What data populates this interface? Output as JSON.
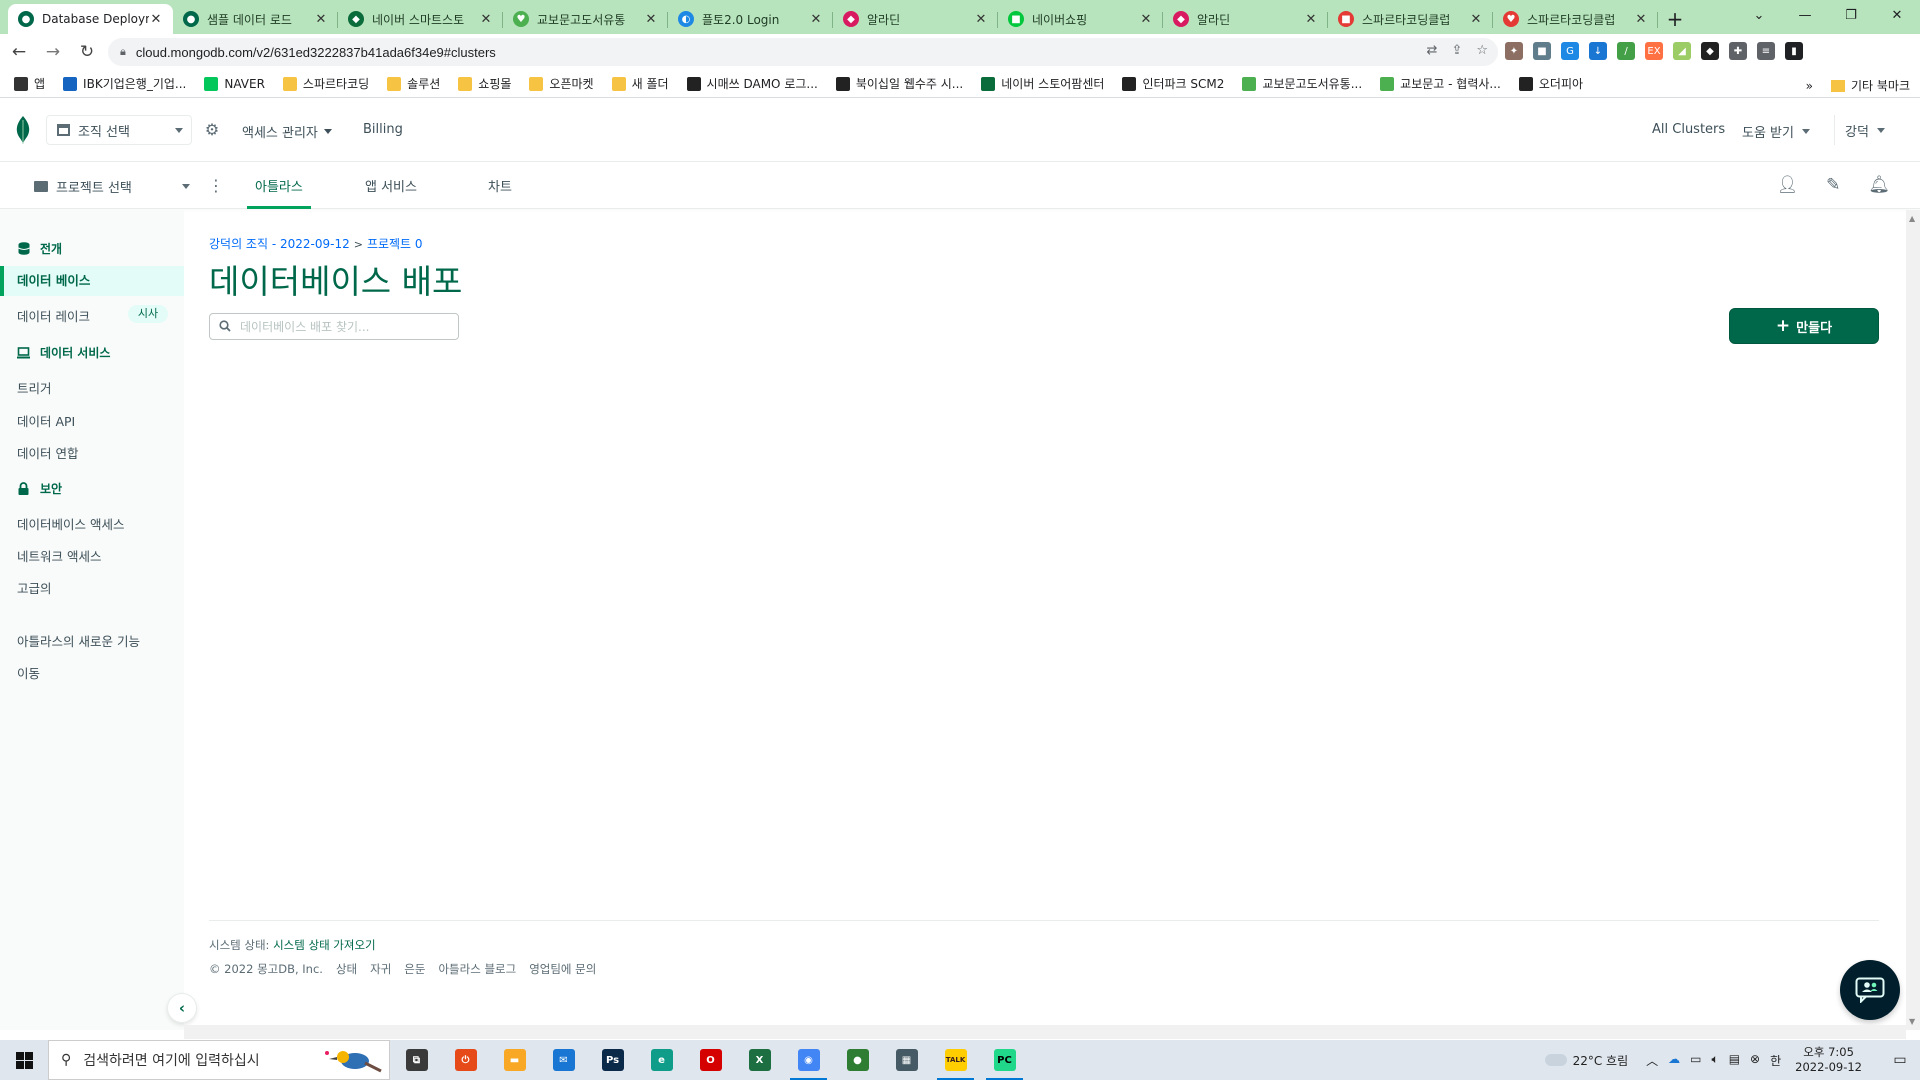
{
  "browser": {
    "tabs": [
      {
        "title": "Database Deploym",
        "color": "#00684a",
        "glyph": "●",
        "active": true
      },
      {
        "title": "샘플 데이터 로드",
        "color": "#00684a",
        "glyph": "●",
        "active": false
      },
      {
        "title": "네이버 스마트스토",
        "color": "#0a6b3b",
        "glyph": "◆",
        "active": false
      },
      {
        "title": "교보문고도서유통",
        "color": "#4caf50",
        "glyph": "♥",
        "active": false
      },
      {
        "title": "플토2.0 Login",
        "color": "#1e88e5",
        "glyph": "◐",
        "active": false
      },
      {
        "title": "알라딘",
        "color": "#d81b60",
        "glyph": "◆",
        "active": false
      },
      {
        "title": "네이버쇼핑",
        "color": "#00c73c",
        "glyph": "■",
        "active": false
      },
      {
        "title": "알라딘",
        "color": "#d81b60",
        "glyph": "◆",
        "active": false
      },
      {
        "title": "스파르타코딩클럽",
        "color": "#e53935",
        "glyph": "■",
        "active": false
      },
      {
        "title": "스파르타코딩클럽",
        "color": "#e53935",
        "glyph": "♥",
        "active": false
      }
    ],
    "new_tab_label": "+",
    "url": "cloud.mongodb.com/v2/631ed3222837b41ada6f34e9#clusters",
    "profile_initials": "강덕",
    "bookmarks": [
      {
        "label": "앱",
        "color": "#333333"
      },
      {
        "label": "IBK기업은행_기업...",
        "color": "#1565c0"
      },
      {
        "label": "NAVER",
        "color": "#03c75a"
      },
      {
        "label": "스파르타코딩",
        "color": "#f6c343"
      },
      {
        "label": "솔루션",
        "color": "#f6c343"
      },
      {
        "label": "쇼핑몰",
        "color": "#f6c343"
      },
      {
        "label": "오픈마켓",
        "color": "#f6c343"
      },
      {
        "label": "새 폴더",
        "color": "#f6c343"
      },
      {
        "label": "시매쓰 DAMO 로그...",
        "color": "#222222"
      },
      {
        "label": "북이십일 웹수주 시...",
        "color": "#222222"
      },
      {
        "label": "네이버 스토어팜센터",
        "color": "#0a6b3b"
      },
      {
        "label": "인터파크 SCM2",
        "color": "#222222"
      },
      {
        "label": "교보문고도서유통...",
        "color": "#4caf50"
      },
      {
        "label": "교보문고 - 협력사...",
        "color": "#4caf50"
      },
      {
        "label": "오더피아",
        "color": "#222222"
      }
    ],
    "bookmarks_overflow": "»",
    "other_bookmarks": "기타 북마크"
  },
  "atlas": {
    "org_select": "조직 선택",
    "access_manager": "액세스 관리자",
    "billing": "Billing",
    "all_clusters": "All Clusters",
    "help": "도움 받기",
    "user": "강덕",
    "project_select": "프로젝트 선택",
    "project_tabs": [
      {
        "label": "아틀라스",
        "active": true
      },
      {
        "label": "앱 서비스",
        "active": false
      },
      {
        "label": "차트",
        "active": false
      }
    ],
    "sidebar": {
      "deployment_head": "전개",
      "database": "데이터 베이스",
      "data_lake": "데이터 레이크",
      "preview_badge": "시사",
      "services_head": "데이터 서비스",
      "triggers": "트리거",
      "data_api": "데이터 API",
      "data_federation": "데이터 연합",
      "security_head": "보안",
      "database_access": "데이터베이스 액세스",
      "network_access": "네트워크 액세스",
      "advanced": "고급의",
      "whats_new": "아틀라스의 새로운 기능",
      "goto": "이동"
    },
    "breadcrumb": {
      "org": "강덕의 조직 - 2022-09-12",
      "separator": ">",
      "project": "프로젝트 0"
    },
    "page_title": "데이터베이스 배포",
    "search_placeholder": "데이터베이스 배포 찾기...",
    "create_button": "만들다",
    "footer": {
      "status_label": "시스템 상태:",
      "status_link": "시스템 상태 가져오기",
      "copyright": "© 2022 몽고DB, Inc.",
      "links": [
        "상태",
        "자귀",
        "은둔",
        "아틀라스 블로그",
        "영업팀에 문의"
      ]
    }
  },
  "taskbar": {
    "search_placeholder": "검색하려면 여기에 입력하십시",
    "apps": [
      {
        "name": "task-view",
        "label": "⧉",
        "color": "#3a3a3a",
        "open": false
      },
      {
        "name": "power-app",
        "label": "⏻",
        "color": "#e64a19",
        "open": false
      },
      {
        "name": "file-explorer",
        "label": "▬",
        "color": "#f9a825",
        "open": false
      },
      {
        "name": "mail",
        "label": "✉",
        "color": "#1976d2",
        "open": false
      },
      {
        "name": "photoshop",
        "label": "Ps",
        "color": "#0b2a4a",
        "open": false
      },
      {
        "name": "edge",
        "label": "e",
        "color": "#0f9d8a",
        "open": false
      },
      {
        "name": "opera",
        "label": "O",
        "color": "#d50000",
        "open": false
      },
      {
        "name": "excel",
        "label": "X",
        "color": "#1d6f42",
        "open": false
      },
      {
        "name": "chrome",
        "label": "◉",
        "color": "#4285f4",
        "open": true
      },
      {
        "name": "green-app",
        "label": "●",
        "color": "#2e7d32",
        "open": false
      },
      {
        "name": "calculator",
        "label": "▦",
        "color": "#455a64",
        "open": false
      },
      {
        "name": "kakaotalk",
        "label": "TALK",
        "color": "#ffcd00",
        "open": true
      },
      {
        "name": "pycharm",
        "label": "PC",
        "color": "#21d789",
        "open": true
      }
    ],
    "weather": "22°C 흐림",
    "ime": "한",
    "time": "오후 7:05",
    "date": "2022-09-12"
  },
  "colors": {
    "accent": "#00684a",
    "accent_light": "#00a35c",
    "link": "#016bf8",
    "tab_strip": "#b8e4bd"
  }
}
